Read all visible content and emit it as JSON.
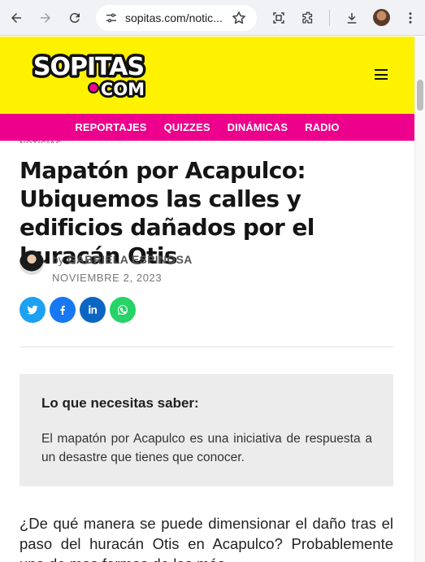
{
  "browser": {
    "url": "sopitas.com/notic...",
    "back_icon": "arrow-left-icon",
    "forward_icon": "arrow-right-icon",
    "reload_icon": "reload-icon"
  },
  "site": {
    "logo_text": "SOPITAS.COM",
    "brand_yellow": "#fff200",
    "brand_pink": "#ec008c"
  },
  "nav": {
    "items": [
      "REPORTAJES",
      "QUIZZES",
      "DINÁMICAS",
      "RADIO"
    ]
  },
  "article": {
    "category": "NOTICIAS",
    "title": "Mapatón por Acapulco: Ubiquemos las calles y edificios dañados por el huracán Otis",
    "by_prefix": "by",
    "author": "GABRIELA ESPINOSA",
    "date": "NOVIEMBRE 2, 2023",
    "share_buttons": [
      {
        "name": "twitter",
        "color": "#1da1f2"
      },
      {
        "name": "facebook",
        "color": "#1877f2"
      },
      {
        "name": "linkedin",
        "color": "#0a66c2"
      },
      {
        "name": "whatsapp",
        "color": "#25d366"
      }
    ],
    "summary_heading": "Lo que necesitas saber:",
    "summary_text": "El mapatón por Acapulco es una iniciativa de respuesta a un desastre que tienes que conocer.",
    "body_start": "¿De qué manera se puede dimensionar el daño tras el paso del huracán Otis en Acapulco? Probablemente una de mas formas de las más"
  }
}
